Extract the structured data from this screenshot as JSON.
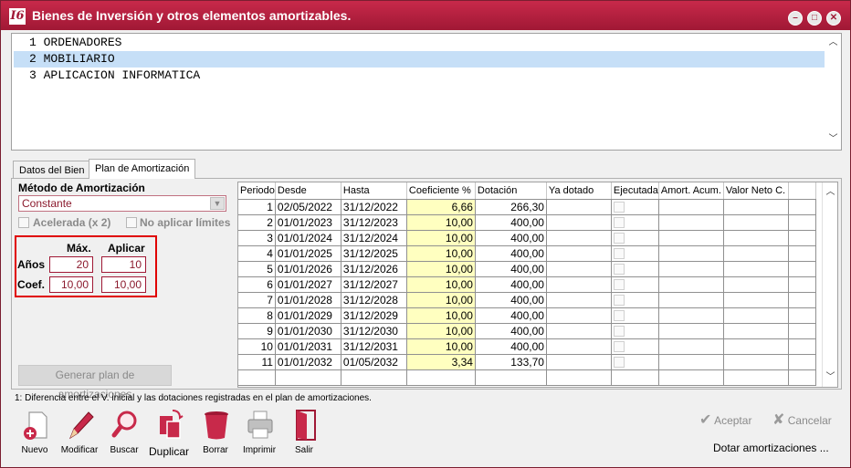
{
  "window": {
    "title": "Bienes de Inversión y otros elementos amortizables.",
    "logo": "I6"
  },
  "items": [
    {
      "label": "1 ORDENADORES",
      "selected": false
    },
    {
      "label": "2 MOBILIARIO",
      "selected": true
    },
    {
      "label": "3 APLICACION INFORMATICA",
      "selected": false
    }
  ],
  "tabs": {
    "datos": "Datos del Bien",
    "plan": "Plan de Amortización"
  },
  "metodo": {
    "label": "Método de Amortización",
    "value": "Constante",
    "acelerada": "Acelerada (x 2)",
    "no_aplicar": "No aplicar límites"
  },
  "limits": {
    "max_header": "Máx.",
    "aplicar_header": "Aplicar",
    "anos_label": "Años",
    "coef_label": "Coef.",
    "anos_max": "20",
    "anos_aplicar": "10",
    "coef_max": "10,00",
    "coef_aplicar": "10,00"
  },
  "generar_label": "Generar plan de amortizaciones",
  "grid": {
    "headers": [
      "Periodo",
      "Desde",
      "Hasta",
      "Coeficiente %",
      "Dotación",
      "Ya dotado",
      "Ejecutada",
      "Amort. Acum.",
      "Valor Neto C."
    ],
    "rows": [
      [
        "1",
        "02/05/2022",
        "31/12/2022",
        "6,66",
        "266,30"
      ],
      [
        "2",
        "01/01/2023",
        "31/12/2023",
        "10,00",
        "400,00"
      ],
      [
        "3",
        "01/01/2024",
        "31/12/2024",
        "10,00",
        "400,00"
      ],
      [
        "4",
        "01/01/2025",
        "31/12/2025",
        "10,00",
        "400,00"
      ],
      [
        "5",
        "01/01/2026",
        "31/12/2026",
        "10,00",
        "400,00"
      ],
      [
        "6",
        "01/01/2027",
        "31/12/2027",
        "10,00",
        "400,00"
      ],
      [
        "7",
        "01/01/2028",
        "31/12/2028",
        "10,00",
        "400,00"
      ],
      [
        "8",
        "01/01/2029",
        "31/12/2029",
        "10,00",
        "400,00"
      ],
      [
        "9",
        "01/01/2030",
        "31/12/2030",
        "10,00",
        "400,00"
      ],
      [
        "10",
        "01/01/2031",
        "31/12/2031",
        "10,00",
        "400,00"
      ],
      [
        "11",
        "01/01/2032",
        "01/05/2032",
        "3,34",
        "133,70"
      ]
    ]
  },
  "footnote": "1: Diferencia entre el V. inicial y las dotaciones registradas en el plan de amortizaciones.",
  "toolbar": {
    "nuevo": "Nuevo",
    "modificar": "Modificar",
    "buscar": "Buscar",
    "duplicar": "Duplicar",
    "borrar": "Borrar",
    "imprimir": "Imprimir",
    "salir": "Salir"
  },
  "actions": {
    "aceptar": "Aceptar",
    "cancelar": "Cancelar",
    "dotar": "Dotar amortizaciones ..."
  },
  "colors": {
    "title_bar": "#a01835",
    "selection": "#c6dff7",
    "coef_cell": "#ffffc0",
    "highlight_box": "#e00000"
  }
}
